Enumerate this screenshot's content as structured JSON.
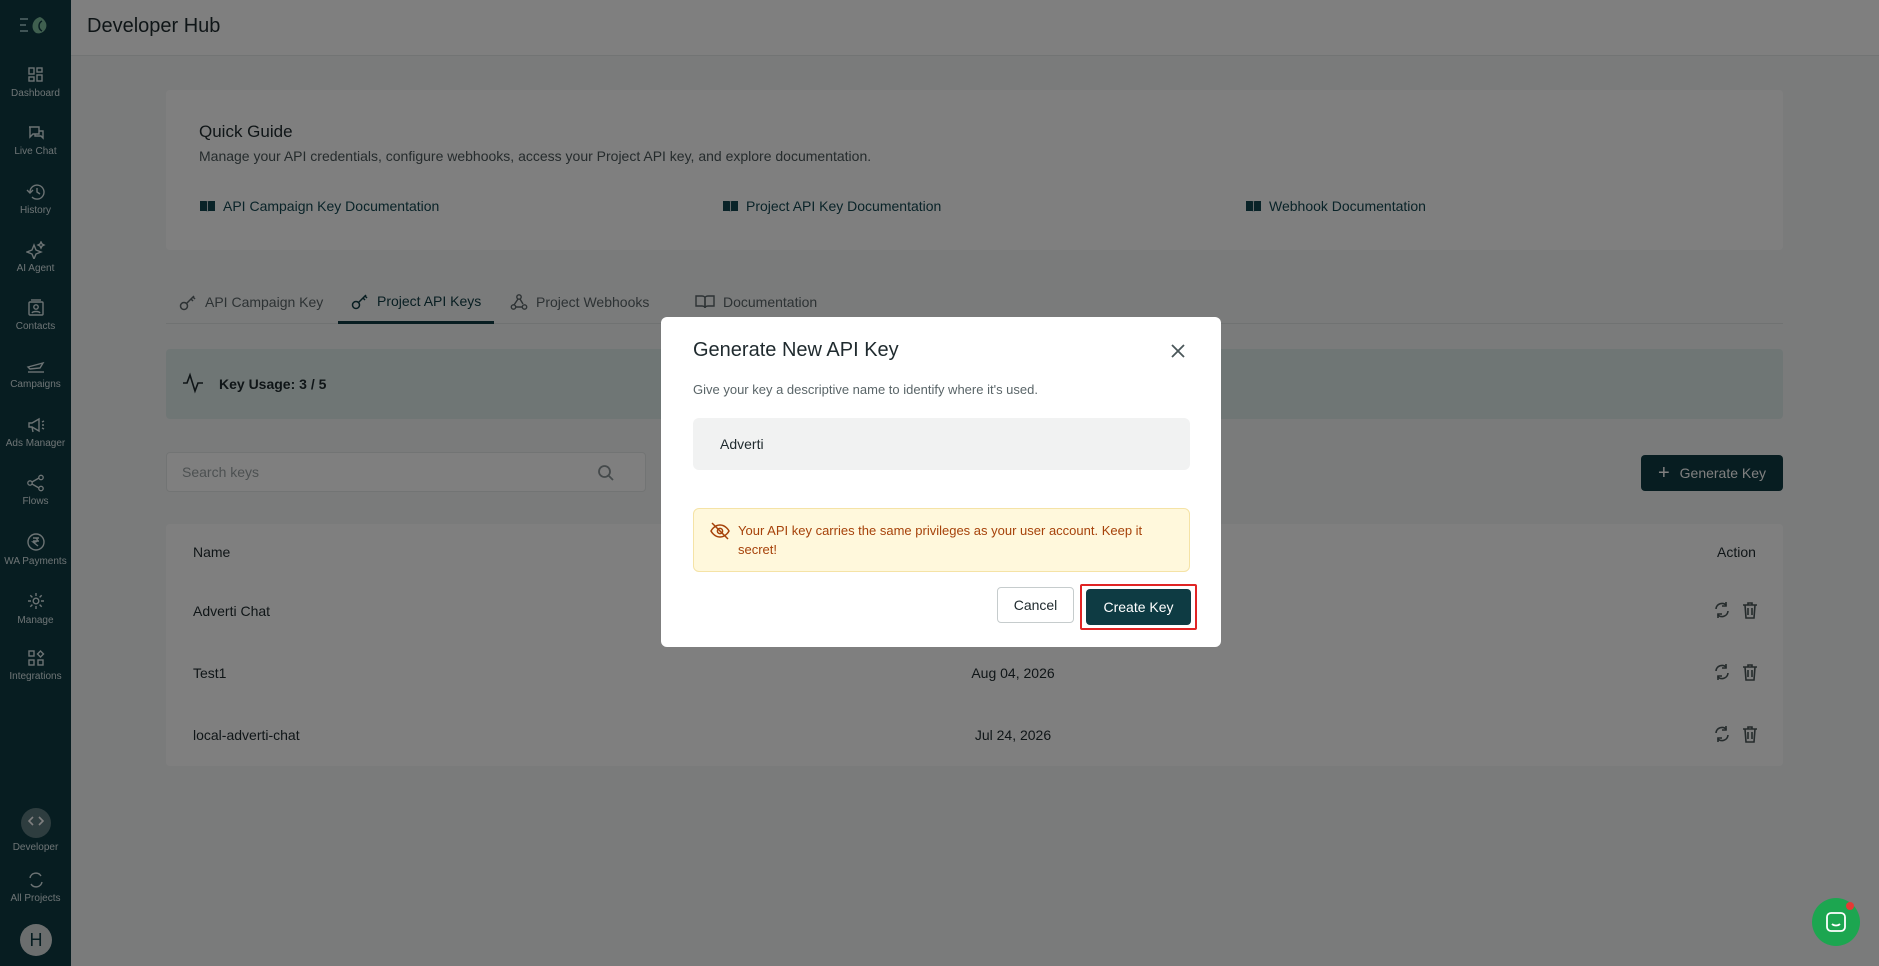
{
  "sidebar": {
    "items": [
      {
        "label": "Dashboard",
        "icon": "dashboard-icon"
      },
      {
        "label": "Live Chat",
        "icon": "chat-icon"
      },
      {
        "label": "History",
        "icon": "history-icon"
      },
      {
        "label": "AI Agent",
        "icon": "sparkle-icon"
      },
      {
        "label": "Contacts",
        "icon": "contacts-icon"
      },
      {
        "label": "Campaigns",
        "icon": "plane-icon"
      },
      {
        "label": "Ads Manager",
        "icon": "megaphone-icon"
      },
      {
        "label": "Flows",
        "icon": "flows-icon"
      },
      {
        "label": "WA Payments",
        "icon": "rupee-icon"
      },
      {
        "label": "Manage",
        "icon": "gear-icon"
      },
      {
        "label": "Integrations",
        "icon": "integrations-icon"
      }
    ],
    "developer": "Developer",
    "all_projects": "All Projects",
    "avatar_initial": "H"
  },
  "header": {
    "title": "Developer Hub"
  },
  "guide": {
    "title": "Quick Guide",
    "description": "Manage your API credentials, configure webhooks, access your Project API key, and explore documentation.",
    "links": [
      "API Campaign Key Documentation",
      "Project API Key Documentation",
      "Webhook Documentation"
    ]
  },
  "tabs": [
    {
      "label": "API Campaign Key",
      "active": false
    },
    {
      "label": "Project API Keys",
      "active": true
    },
    {
      "label": "Project Webhooks",
      "active": false
    },
    {
      "label": "Documentation",
      "active": false
    }
  ],
  "usage": {
    "text": "Key Usage: 3 / 5"
  },
  "search": {
    "placeholder": "Search keys"
  },
  "generate_button": "Generate Key",
  "table": {
    "headers": {
      "name": "Name",
      "action": "Action"
    },
    "rows": [
      {
        "name": "Adverti Chat",
        "date": ""
      },
      {
        "name": "Test1",
        "date": "Aug 04, 2026"
      },
      {
        "name": "local-adverti-chat",
        "date": "Jul 24, 2026"
      }
    ]
  },
  "modal": {
    "title": "Generate New API Key",
    "subtitle": "Give your key a descriptive name to identify where it's used.",
    "input_value": "Adverti",
    "warning": "Your API key carries the same privileges as your user account. Keep it secret!",
    "cancel": "Cancel",
    "create": "Create Key"
  },
  "colors": {
    "brand": "#0e3b43",
    "warning_text": "#a6420a",
    "chat": "#1ca650",
    "highlight": "#e02424"
  }
}
